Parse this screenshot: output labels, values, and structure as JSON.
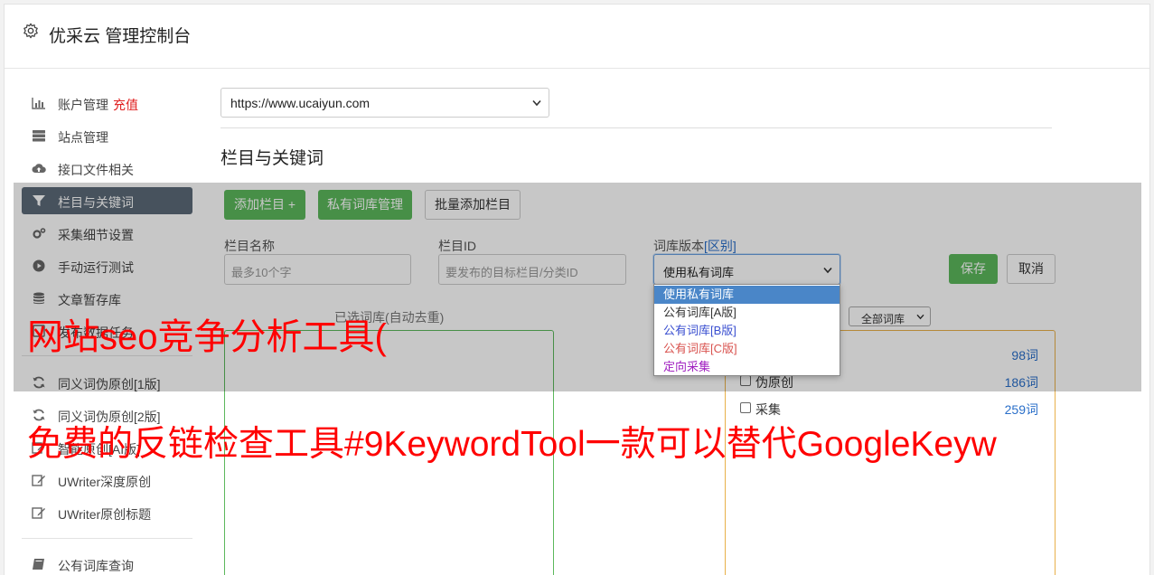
{
  "header": {
    "title": "优采云 管理控制台"
  },
  "sidebar": {
    "items": [
      {
        "label": "账户管理",
        "badge": "充值",
        "icon": "bar-chart-icon"
      },
      {
        "label": "站点管理",
        "icon": "server-icon"
      },
      {
        "label": "接口文件相关",
        "icon": "cloud-upload-icon"
      },
      {
        "label": "栏目与关键词",
        "icon": "filter-icon",
        "active": true
      },
      {
        "label": "采集细节设置",
        "icon": "cogs-icon"
      },
      {
        "label": "手动运行测试",
        "icon": "play-circle-icon"
      },
      {
        "label": "文章暂存库",
        "icon": "database-icon"
      },
      {
        "label": "发布数据任务",
        "icon": "task-icon"
      },
      {
        "label": "同义词伪原创[1版]",
        "icon": "refresh-icon"
      },
      {
        "label": "同义词伪原创[2版]",
        "icon": "refresh-icon"
      },
      {
        "label": "智能原创[AI版]",
        "icon": "edit-icon"
      },
      {
        "label": "UWriter深度原创",
        "icon": "edit-icon"
      },
      {
        "label": "UWriter原创标题",
        "icon": "edit-icon"
      },
      {
        "label": "公有词库查询",
        "icon": "book-icon"
      }
    ]
  },
  "site_select": {
    "value": "https://www.ucaiyun.com"
  },
  "section": {
    "title": "栏目与关键词"
  },
  "toolbar": {
    "add_column": "添加栏目 +",
    "private_lexicon": "私有词库管理",
    "batch_add": "批量添加栏目"
  },
  "form": {
    "name_label": "栏目名称",
    "name_placeholder": "最多10个字",
    "id_label": "栏目ID",
    "id_placeholder": "要发布的目标栏目/分类ID",
    "version_label": "词库版本",
    "version_diff": "[区别]",
    "version_value": "使用私有词库",
    "save": "保存",
    "cancel": "取消"
  },
  "dropdown": {
    "options": [
      {
        "label": "使用私有词库",
        "color": "#ffffff",
        "selected": true
      },
      {
        "label": "公有词库[A版]",
        "color": "#333333"
      },
      {
        "label": "公有词库[B版]",
        "color": "#3a4fd0"
      },
      {
        "label": "公有词库[C版]",
        "color": "#d9534f"
      },
      {
        "label": "定向采集",
        "color": "#a020c0"
      }
    ]
  },
  "selected_box": {
    "label": "已选词库(自动去重)"
  },
  "lexicon_box": {
    "filter": "全部词库",
    "rows": [
      {
        "label": "伪原创",
        "count": "186词"
      },
      {
        "label": "采集",
        "count": "259词"
      }
    ],
    "first_count": "98词"
  },
  "watermark": {
    "line1": "网站seo竞争分析工具(",
    "line2": "免费的反链检查工具#9KeywordTool一款可以替代GoogleKeyw"
  }
}
